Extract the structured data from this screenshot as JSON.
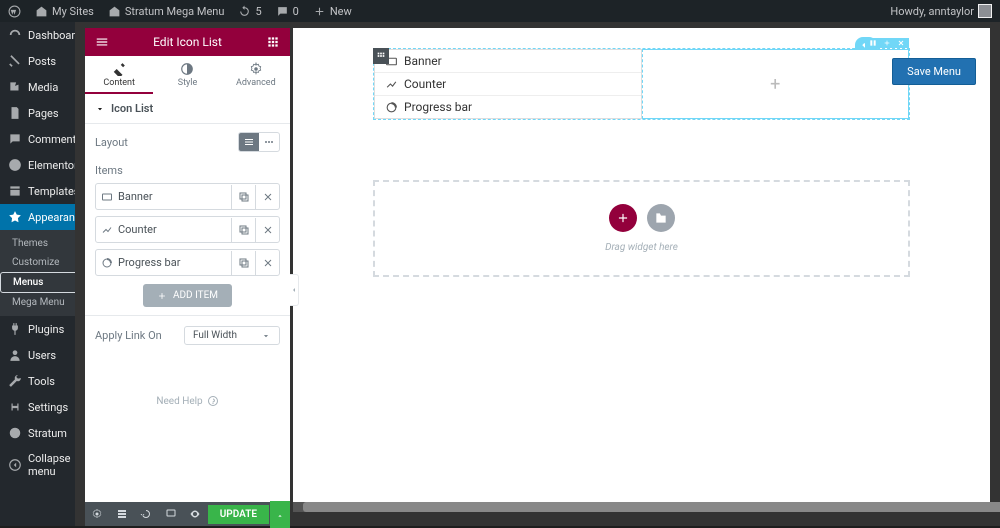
{
  "wpbar": {
    "mysites": "My Sites",
    "sitename": "Stratum Mega Menu",
    "updates": "5",
    "comments": "0",
    "new": "New",
    "howdy": "Howdy, anntaylor"
  },
  "wpside": {
    "items": [
      {
        "label": "Dashboard"
      },
      {
        "label": "Posts"
      },
      {
        "label": "Media"
      },
      {
        "label": "Pages"
      },
      {
        "label": "Comments"
      },
      {
        "label": "Elementor"
      },
      {
        "label": "Templates"
      },
      {
        "label": "Appearance"
      },
      {
        "label": "Plugins"
      },
      {
        "label": "Users"
      },
      {
        "label": "Tools"
      },
      {
        "label": "Settings"
      },
      {
        "label": "Stratum"
      },
      {
        "label": "Collapse menu"
      }
    ],
    "sub": [
      {
        "label": "Themes"
      },
      {
        "label": "Customize"
      },
      {
        "label": "Menus"
      },
      {
        "label": "Mega Menu"
      }
    ]
  },
  "overlay": {
    "save": "Save Menu"
  },
  "panel": {
    "title": "Edit Icon List",
    "tabs": {
      "content": "Content",
      "style": "Style",
      "advanced": "Advanced"
    },
    "section": "Icon List",
    "layout_label": "Layout",
    "items_label": "Items",
    "items": [
      {
        "label": "Banner"
      },
      {
        "label": "Counter"
      },
      {
        "label": "Progress bar"
      }
    ],
    "add_item": "ADD ITEM",
    "apply_link_label": "Apply Link On",
    "apply_link_value": "Full Width",
    "need_help": "Need Help",
    "update": "UPDATE"
  },
  "canvas": {
    "list": [
      "Banner",
      "Counter",
      "Progress bar"
    ],
    "drag_text": "Drag widget here"
  }
}
